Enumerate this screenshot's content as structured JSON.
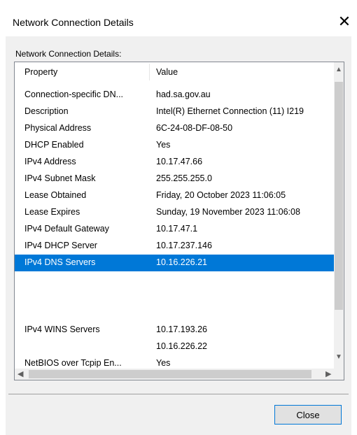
{
  "window": {
    "title": "Network Connection Details",
    "close_glyph": "✕"
  },
  "dialog": {
    "group_label": "Network Connection Details:",
    "close_label": "Close"
  },
  "table": {
    "headers": {
      "property": "Property",
      "value": "Value"
    },
    "rows": [
      {
        "property": "Connection-specific DN...",
        "value": "had.sa.gov.au"
      },
      {
        "property": "Description",
        "value": "Intel(R) Ethernet Connection (11) I219"
      },
      {
        "property": "Physical Address",
        "value": "6C-24-08-DF-08-50"
      },
      {
        "property": "DHCP Enabled",
        "value": "Yes"
      },
      {
        "property": "IPv4 Address",
        "value": "10.17.47.66"
      },
      {
        "property": "IPv4 Subnet Mask",
        "value": "255.255.255.0"
      },
      {
        "property": "Lease Obtained",
        "value": "Friday, 20 October 2023 11:06:05"
      },
      {
        "property": "Lease Expires",
        "value": "Sunday, 19 November 2023 11:06:08"
      },
      {
        "property": "IPv4 Default Gateway",
        "value": "10.17.47.1"
      },
      {
        "property": "IPv4 DHCP Server",
        "value": "10.17.237.146"
      },
      {
        "property": "IPv4 DNS Servers",
        "value": "10.16.226.21",
        "selected": true
      },
      {
        "property": "",
        "value": ""
      },
      {
        "property": "",
        "value": ""
      },
      {
        "property": "",
        "value": ""
      },
      {
        "property": "IPv4 WINS Servers",
        "value": "10.17.193.26"
      },
      {
        "property": "",
        "value": "10.16.226.22"
      },
      {
        "property": "NetBIOS over Tcpip En...",
        "value": "Yes"
      }
    ]
  },
  "colors": {
    "selection": "#0078d7",
    "accent": "#0078d7"
  }
}
